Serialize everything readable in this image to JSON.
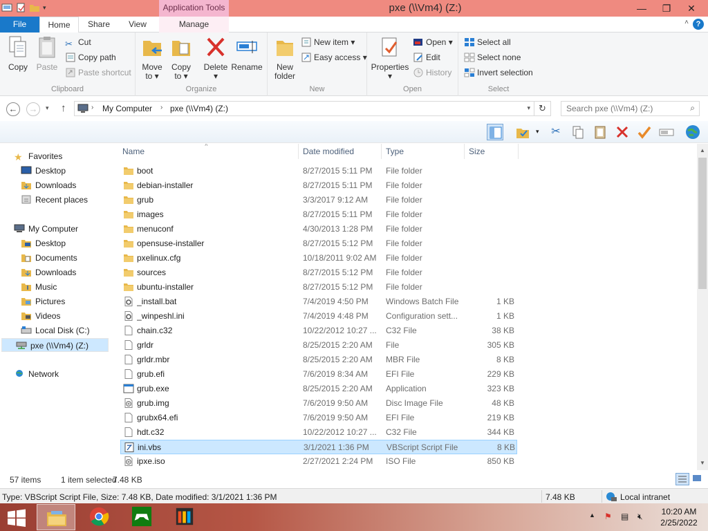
{
  "window": {
    "title": "pxe (\\\\Vm4) (Z:)",
    "context_tab_group": "Application Tools",
    "buttons": {
      "minimize": "—",
      "maximize": "❐",
      "close": "✕"
    }
  },
  "tabs": [
    "File",
    "Home",
    "Share",
    "View",
    "Manage"
  ],
  "ribbon": {
    "clipboard": {
      "label": "Clipboard",
      "copy": "Copy",
      "paste": "Paste",
      "cut": "Cut",
      "copy_path": "Copy path",
      "paste_shortcut": "Paste shortcut"
    },
    "organize": {
      "label": "Organize",
      "move_to": [
        "Move",
        "to ▾"
      ],
      "copy_to": [
        "Copy",
        "to ▾"
      ],
      "delete": [
        "Delete",
        "▾"
      ],
      "rename": "Rename"
    },
    "new": {
      "label": "New",
      "new_folder": [
        "New",
        "folder"
      ],
      "new_item": "New item ▾",
      "easy_access": "Easy access ▾"
    },
    "open": {
      "label": "Open",
      "properties": [
        "Properties",
        "▾"
      ],
      "open": "Open ▾",
      "edit": "Edit",
      "history": "History"
    },
    "select": {
      "label": "Select",
      "select_all": "Select all",
      "select_none": "Select none",
      "invert": "Invert selection"
    }
  },
  "address": {
    "segments": [
      "My Computer",
      "pxe (\\\\Vm4) (Z:)"
    ],
    "search_placeholder": "Search pxe (\\\\Vm4) (Z:)"
  },
  "nav": {
    "favorites": "Favorites",
    "fav_items": [
      "Desktop",
      "Downloads",
      "Recent places"
    ],
    "computer": "My Computer",
    "computer_items": [
      "Desktop",
      "Documents",
      "Downloads",
      "Music",
      "Pictures",
      "Videos",
      "Local Disk (C:)",
      "pxe (\\\\Vm4) (Z:)"
    ],
    "network": "Network"
  },
  "columns": {
    "name": "Name",
    "date": "Date modified",
    "type": "Type",
    "size": "Size"
  },
  "files": [
    {
      "name": "boot",
      "date": "8/27/2015 5:11 PM",
      "type": "File folder",
      "size": "",
      "icon": "folder"
    },
    {
      "name": "debian-installer",
      "date": "8/27/2015 5:11 PM",
      "type": "File folder",
      "size": "",
      "icon": "folder"
    },
    {
      "name": "grub",
      "date": "3/3/2017 9:12 AM",
      "type": "File folder",
      "size": "",
      "icon": "folder"
    },
    {
      "name": "images",
      "date": "8/27/2015 5:11 PM",
      "type": "File folder",
      "size": "",
      "icon": "folder"
    },
    {
      "name": "menuconf",
      "date": "4/30/2013 1:28 PM",
      "type": "File folder",
      "size": "",
      "icon": "folder"
    },
    {
      "name": "opensuse-installer",
      "date": "8/27/2015 5:12 PM",
      "type": "File folder",
      "size": "",
      "icon": "folder"
    },
    {
      "name": "pxelinux.cfg",
      "date": "10/18/2011 9:02 AM",
      "type": "File folder",
      "size": "",
      "icon": "folder"
    },
    {
      "name": "sources",
      "date": "8/27/2015 5:12 PM",
      "type": "File folder",
      "size": "",
      "icon": "folder"
    },
    {
      "name": "ubuntu-installer",
      "date": "8/27/2015 5:12 PM",
      "type": "File folder",
      "size": "",
      "icon": "folder"
    },
    {
      "name": "_install.bat",
      "date": "7/4/2019 4:50 PM",
      "type": "Windows Batch File",
      "size": "1 KB",
      "icon": "gear"
    },
    {
      "name": "_winpeshl.ini",
      "date": "7/4/2019 4:48 PM",
      "type": "Configuration sett...",
      "size": "1 KB",
      "icon": "gear"
    },
    {
      "name": "chain.c32",
      "date": "10/22/2012 10:27 ...",
      "type": "C32 File",
      "size": "38 KB",
      "icon": "file"
    },
    {
      "name": "grldr",
      "date": "8/25/2015 2:20 AM",
      "type": "File",
      "size": "305 KB",
      "icon": "file"
    },
    {
      "name": "grldr.mbr",
      "date": "8/25/2015 2:20 AM",
      "type": "MBR File",
      "size": "8 KB",
      "icon": "file"
    },
    {
      "name": "grub.efi",
      "date": "7/6/2019 8:34 AM",
      "type": "EFI File",
      "size": "229 KB",
      "icon": "file"
    },
    {
      "name": "grub.exe",
      "date": "8/25/2015 2:20 AM",
      "type": "Application",
      "size": "323 KB",
      "icon": "app"
    },
    {
      "name": "grub.img",
      "date": "7/6/2019 9:50 AM",
      "type": "Disc Image File",
      "size": "48 KB",
      "icon": "disc"
    },
    {
      "name": "grubx64.efi",
      "date": "7/6/2019 9:50 AM",
      "type": "EFI File",
      "size": "219 KB",
      "icon": "file"
    },
    {
      "name": "hdt.c32",
      "date": "10/22/2012 10:27 ...",
      "type": "C32 File",
      "size": "344 KB",
      "icon": "file"
    },
    {
      "name": "ini.vbs",
      "date": "3/1/2021 1:36 PM",
      "type": "VBScript Script File",
      "size": "8 KB",
      "icon": "script"
    },
    {
      "name": "ipxe.iso",
      "date": "2/27/2021 2:24 PM",
      "type": "ISO File",
      "size": "850 KB",
      "icon": "disc"
    }
  ],
  "selected_file": "ini.vbs",
  "status": {
    "count": "57 items",
    "selected": "1 item selected",
    "sel_size": "7.48 KB"
  },
  "details": {
    "info": "Type: VBScript Script File, Size: 7.48 KB, Date modified: 3/1/2021 1:36 PM",
    "size": "7.48 KB",
    "zone": "Local intranet"
  },
  "clock": {
    "time": "10:20 AM",
    "date": "2/25/2022"
  },
  "colors": {
    "accent": "#1979ca",
    "title_bar": "#ef8a80",
    "selection": "#cce8ff",
    "folder": "#e8b84a"
  }
}
